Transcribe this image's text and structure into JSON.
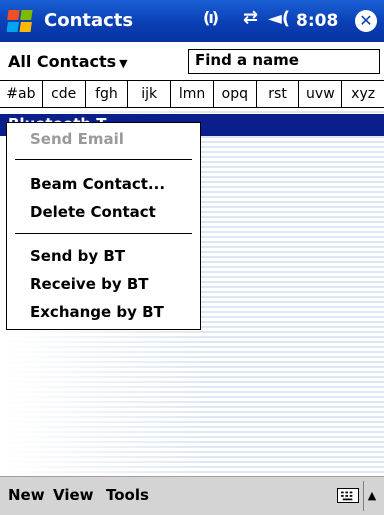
{
  "titlebar": {
    "app_title": "Contacts",
    "clock": "8:08",
    "signal_glyph": "(ı)",
    "conn_glyph": "⇄",
    "volume_glyph": "◄(",
    "close_glyph": "✕",
    "icons": [
      "start-flag-icon",
      "signal-icon",
      "connectivity-icon",
      "volume-icon",
      "close-icon"
    ]
  },
  "toolbar": {
    "filter_label": "All Contacts",
    "filter_arrow": "▼",
    "find_value": "Find a name"
  },
  "alpha_tabs": [
    "#ab",
    "cde",
    "fgh",
    "ijk",
    "lmn",
    "opq",
    "rst",
    "uvw",
    "xyz"
  ],
  "list": {
    "selected_contact": "Bluetooth T"
  },
  "context_menu": {
    "items": [
      {
        "label": "Send Email",
        "enabled": false
      },
      {
        "label": "Beam Contact...",
        "enabled": true
      },
      {
        "label": "Delete Contact",
        "enabled": true
      },
      {
        "label": "Send by BT",
        "enabled": true
      },
      {
        "label": "Receive by BT",
        "enabled": true
      },
      {
        "label": "Exchange by BT",
        "enabled": true
      }
    ]
  },
  "menubar": {
    "new": "New",
    "view": "View",
    "tools": "Tools",
    "sip_arrow": "▲"
  },
  "colors": {
    "titlebar": "#0a3fb5",
    "selection": "#0a1e8c",
    "menubar": "#d4d4d4"
  }
}
